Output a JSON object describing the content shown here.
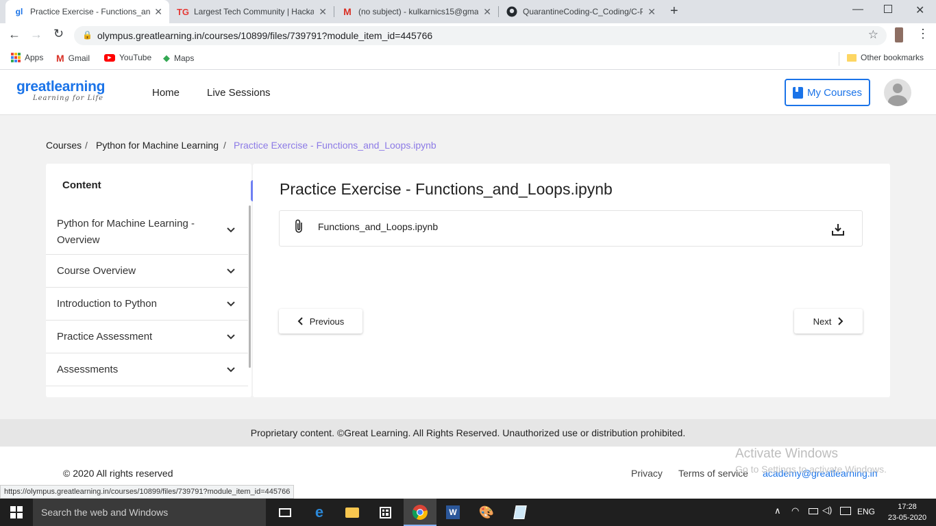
{
  "browser": {
    "tabs": [
      {
        "title": "Practice Exercise - Functions_and_",
        "favicon": "gl-favicon",
        "active": true
      },
      {
        "title": "Largest Tech Community | Hackat",
        "favicon": "tg-favicon",
        "active": false
      },
      {
        "title": "(no subject) - kulkarnics15@gma",
        "favicon": "gmail-favicon",
        "active": false
      },
      {
        "title": "QuarantineCoding-C_Coding/C-P",
        "favicon": "github-favicon",
        "active": false
      }
    ],
    "url": "olympus.greatlearning.in/courses/10899/files/739791?module_item_id=445766",
    "bookmarks": [
      "Apps",
      "Gmail",
      "YouTube",
      "Maps"
    ],
    "other_bookmarks": "Other bookmarks",
    "status_url": "https://olympus.greatlearning.in/courses/10899/files/739791?module_item_id=445766"
  },
  "site": {
    "logo_main": "greatlearning",
    "logo_tag": "Learning for Life",
    "nav": [
      "Home",
      "Live Sessions"
    ],
    "my_courses": "My Courses",
    "accent": "#1a73e8",
    "breadcrumb": [
      "Courses",
      "Python for Machine Learning",
      "Practice Exercise - Functions_and_Loops.ipynb"
    ],
    "breadcrumb_sep": "/"
  },
  "sidebar": {
    "title": "Content",
    "collapse_icon": "«",
    "items": [
      {
        "label": "Python for Machine Learning - Overview"
      },
      {
        "label": "Course Overview"
      },
      {
        "label": "Introduction to Python"
      },
      {
        "label": "Practice Assessment"
      },
      {
        "label": "Assessments"
      }
    ]
  },
  "main": {
    "title": "Practice Exercise - Functions_and_Loops.ipynb",
    "file_name": "Functions_and_Loops.ipynb",
    "prev_label": "Previous",
    "next_label": "Next"
  },
  "footer": {
    "notice": "Proprietary content. ©Great Learning. All Rights Reserved. Unauthorized use or distribution prohibited.",
    "copyright": "© 2020 All rights reserved",
    "privacy": "Privacy",
    "terms": "Terms of service",
    "email": "academy@greatlearning.in",
    "watermark_title": "Activate Windows",
    "watermark_sub": "Go to Settings to activate Windows."
  },
  "taskbar": {
    "search_placeholder": "Search the web and Windows",
    "lang": "ENG",
    "time": "17:28",
    "date": "23-05-2020"
  }
}
